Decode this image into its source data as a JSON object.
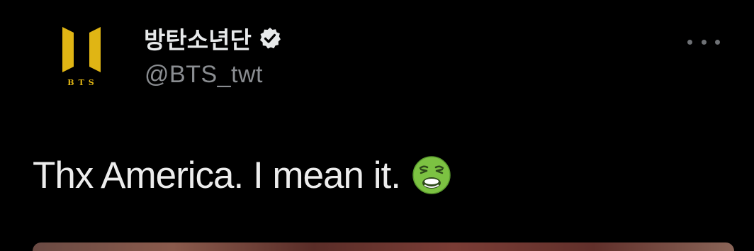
{
  "tweet": {
    "display_name": "방탄소년단",
    "handle": "@BTS_twt",
    "text": "Thx America. I mean it.",
    "avatar_text": "BTS",
    "avatar_icon": "bts-logo-icon",
    "verified_icon": "verified-badge-icon",
    "emoji": "nauseated-face-emoji",
    "more_icon": "more-options-icon"
  },
  "colors": {
    "background": "#000000",
    "text_primary": "#e7e9ea",
    "text_secondary": "#8a8d91",
    "brand_gold": "#e0b514"
  }
}
